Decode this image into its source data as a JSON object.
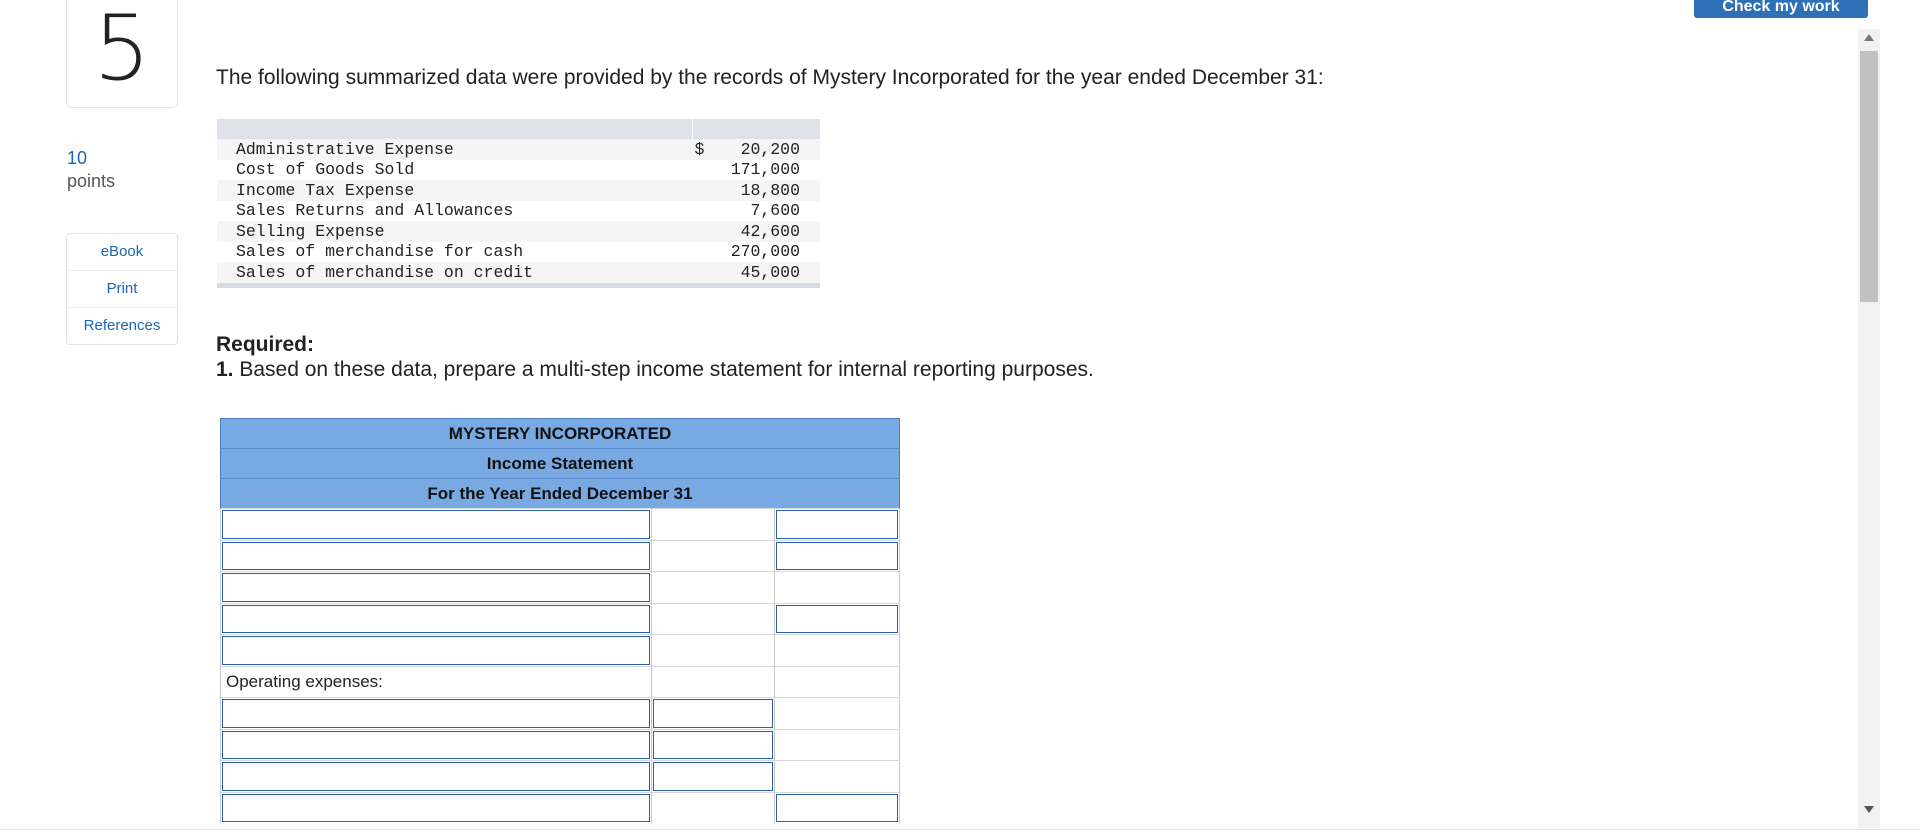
{
  "question": {
    "number": "5",
    "points_value": "10",
    "points_label": "points"
  },
  "side_links": {
    "ebook": "eBook",
    "print": "Print",
    "references": "References"
  },
  "top_button": {
    "label": "Check my work"
  },
  "intro": "The following summarized data were provided by the records of Mystery Incorporated for the year ended December 31:",
  "data_table": {
    "currency_symbol": "$",
    "rows": [
      {
        "label": "Administrative Expense",
        "value": "20,200"
      },
      {
        "label": "Cost of Goods Sold",
        "value": "171,000"
      },
      {
        "label": "Income Tax Expense",
        "value": "18,800"
      },
      {
        "label": "Sales Returns and Allowances",
        "value": "7,600"
      },
      {
        "label": "Selling Expense",
        "value": "42,600"
      },
      {
        "label": "Sales of merchandise for cash",
        "value": "270,000"
      },
      {
        "label": "Sales of merchandise on credit",
        "value": "45,000"
      }
    ]
  },
  "required": {
    "title": "Required:",
    "item_number": "1.",
    "item_text": "Based on these data, prepare a multi-step income statement for internal reporting purposes."
  },
  "statement": {
    "company": "MYSTERY INCORPORATED",
    "title": "Income Statement",
    "period": "For the Year Ended December 31",
    "operating_expenses_label": "Operating expenses:"
  }
}
